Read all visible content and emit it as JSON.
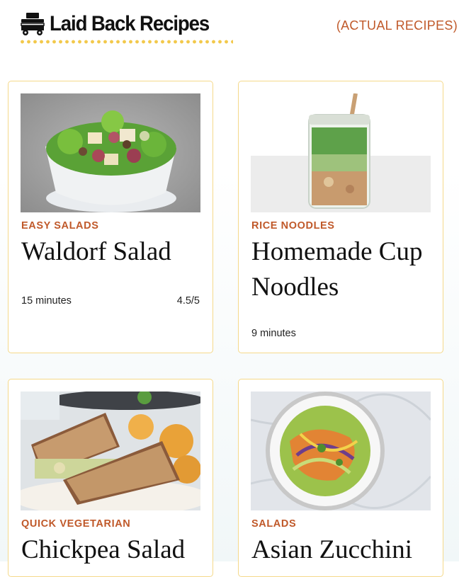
{
  "header": {
    "logo_text": "Laid Back Recipes",
    "nav_link": "(ACTUAL RECIPES)"
  },
  "cards": [
    {
      "category": "EASY SALADS",
      "title": "Waldorf Salad",
      "time": "15 minutes",
      "rating": "4.5/5"
    },
    {
      "category": "RICE NOODLES",
      "title": "Homemade Cup Noodles",
      "time": "9 minutes",
      "rating": ""
    },
    {
      "category": "QUICK VEGETARIAN",
      "title": "Chickpea Salad",
      "time": "",
      "rating": ""
    },
    {
      "category": "SALADS",
      "title": "Asian Zucchini",
      "time": "",
      "rating": ""
    }
  ],
  "colors": {
    "accent": "#c0592a",
    "border": "#f5d98a",
    "dots": "#f2c94c"
  }
}
